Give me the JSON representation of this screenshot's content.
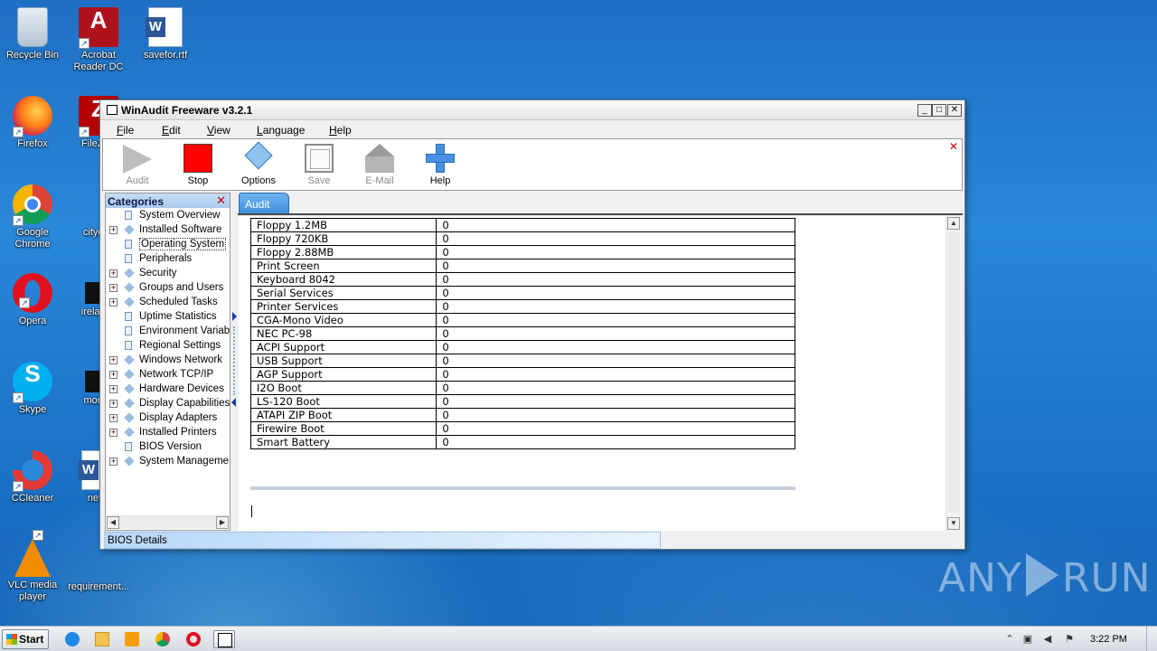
{
  "desktop": {
    "icons": [
      {
        "label": "Recycle Bin"
      },
      {
        "label": "Acrobat Reader DC"
      },
      {
        "label": "savefor.rtf"
      },
      {
        "label": "Firefox"
      },
      {
        "label": "FileZilla"
      },
      {
        "label": "Google Chrome"
      },
      {
        "label": "cityexp"
      },
      {
        "label": "Opera"
      },
      {
        "label": "irelandv"
      },
      {
        "label": "Skype"
      },
      {
        "label": "monito"
      },
      {
        "label": "CCleaner"
      },
      {
        "label": "netto"
      },
      {
        "label": "VLC media player"
      },
      {
        "label": "requirement..."
      }
    ]
  },
  "window": {
    "title": "WinAudit Freeware v3.2.1",
    "controls": {
      "minimize": "_",
      "maximize": "□",
      "close": "✕"
    },
    "menu": [
      "File",
      "Edit",
      "View",
      "Language",
      "Help"
    ],
    "toolbar": [
      {
        "label": "Audit",
        "icon": "play-icon",
        "enabled": false
      },
      {
        "label": "Stop",
        "icon": "stop-icon",
        "enabled": true
      },
      {
        "label": "Options",
        "icon": "diamond-icon",
        "enabled": true
      },
      {
        "label": "Save",
        "icon": "save-icon",
        "enabled": false
      },
      {
        "label": "E-Mail",
        "icon": "house-icon",
        "enabled": false
      },
      {
        "label": "Help",
        "icon": "plus-icon",
        "enabled": true
      }
    ],
    "toolbar_close": "✕",
    "categories": {
      "title": "Categories",
      "close": "✕",
      "selected": "Operating System",
      "items": [
        {
          "label": "System Overview",
          "expandable": false,
          "icon": "page"
        },
        {
          "label": "Installed Software",
          "expandable": true,
          "icon": "diamond"
        },
        {
          "label": "Operating System",
          "expandable": false,
          "icon": "page"
        },
        {
          "label": "Peripherals",
          "expandable": false,
          "icon": "page"
        },
        {
          "label": "Security",
          "expandable": true,
          "icon": "diamond"
        },
        {
          "label": "Groups and Users",
          "expandable": true,
          "icon": "diamond"
        },
        {
          "label": "Scheduled Tasks",
          "expandable": true,
          "icon": "diamond"
        },
        {
          "label": "Uptime Statistics",
          "expandable": false,
          "icon": "page"
        },
        {
          "label": "Environment Variable",
          "expandable": false,
          "icon": "page"
        },
        {
          "label": "Regional Settings",
          "expandable": false,
          "icon": "page"
        },
        {
          "label": "Windows Network",
          "expandable": true,
          "icon": "diamond"
        },
        {
          "label": "Network TCP/IP",
          "expandable": true,
          "icon": "diamond"
        },
        {
          "label": "Hardware Devices",
          "expandable": true,
          "icon": "diamond"
        },
        {
          "label": "Display Capabilities",
          "expandable": true,
          "icon": "diamond"
        },
        {
          "label": "Display Adapters",
          "expandable": true,
          "icon": "diamond"
        },
        {
          "label": "Installed Printers",
          "expandable": true,
          "icon": "diamond"
        },
        {
          "label": "BIOS Version",
          "expandable": false,
          "icon": "page"
        },
        {
          "label": "System Management",
          "expandable": true,
          "icon": "diamond"
        }
      ]
    },
    "tab": "Audit",
    "rows": [
      [
        "Floppy 1.2MB",
        "0"
      ],
      [
        "Floppy 720KB",
        "0"
      ],
      [
        "Floppy 2.88MB",
        "0"
      ],
      [
        "Print Screen",
        "0"
      ],
      [
        "Keyboard 8042",
        "0"
      ],
      [
        "Serial Services",
        "0"
      ],
      [
        "Printer Services",
        "0"
      ],
      [
        "CGA-Mono Video",
        "0"
      ],
      [
        "NEC PC-98",
        "0"
      ],
      [
        "ACPI Support",
        "0"
      ],
      [
        "USB Support",
        "0"
      ],
      [
        "AGP Support",
        "0"
      ],
      [
        "I2O Boot",
        "0"
      ],
      [
        "LS-120 Boot",
        "0"
      ],
      [
        "ATAPI ZIP Boot",
        "0"
      ],
      [
        "Firewire Boot",
        "0"
      ],
      [
        "Smart Battery",
        "0"
      ]
    ],
    "status": "BIOS Details"
  },
  "watermark": {
    "left": "ANY",
    "right": "RUN"
  },
  "taskbar": {
    "start": "Start",
    "items": [
      "internet-explorer-icon",
      "folder-icon",
      "media-player-icon",
      "chrome-icon",
      "opera-icon",
      "winaudit-icon"
    ],
    "clock": "3:22 PM"
  },
  "colors": {
    "accent": "#3e8fdc",
    "stop": "#ff0000",
    "close": "#cc0000"
  }
}
